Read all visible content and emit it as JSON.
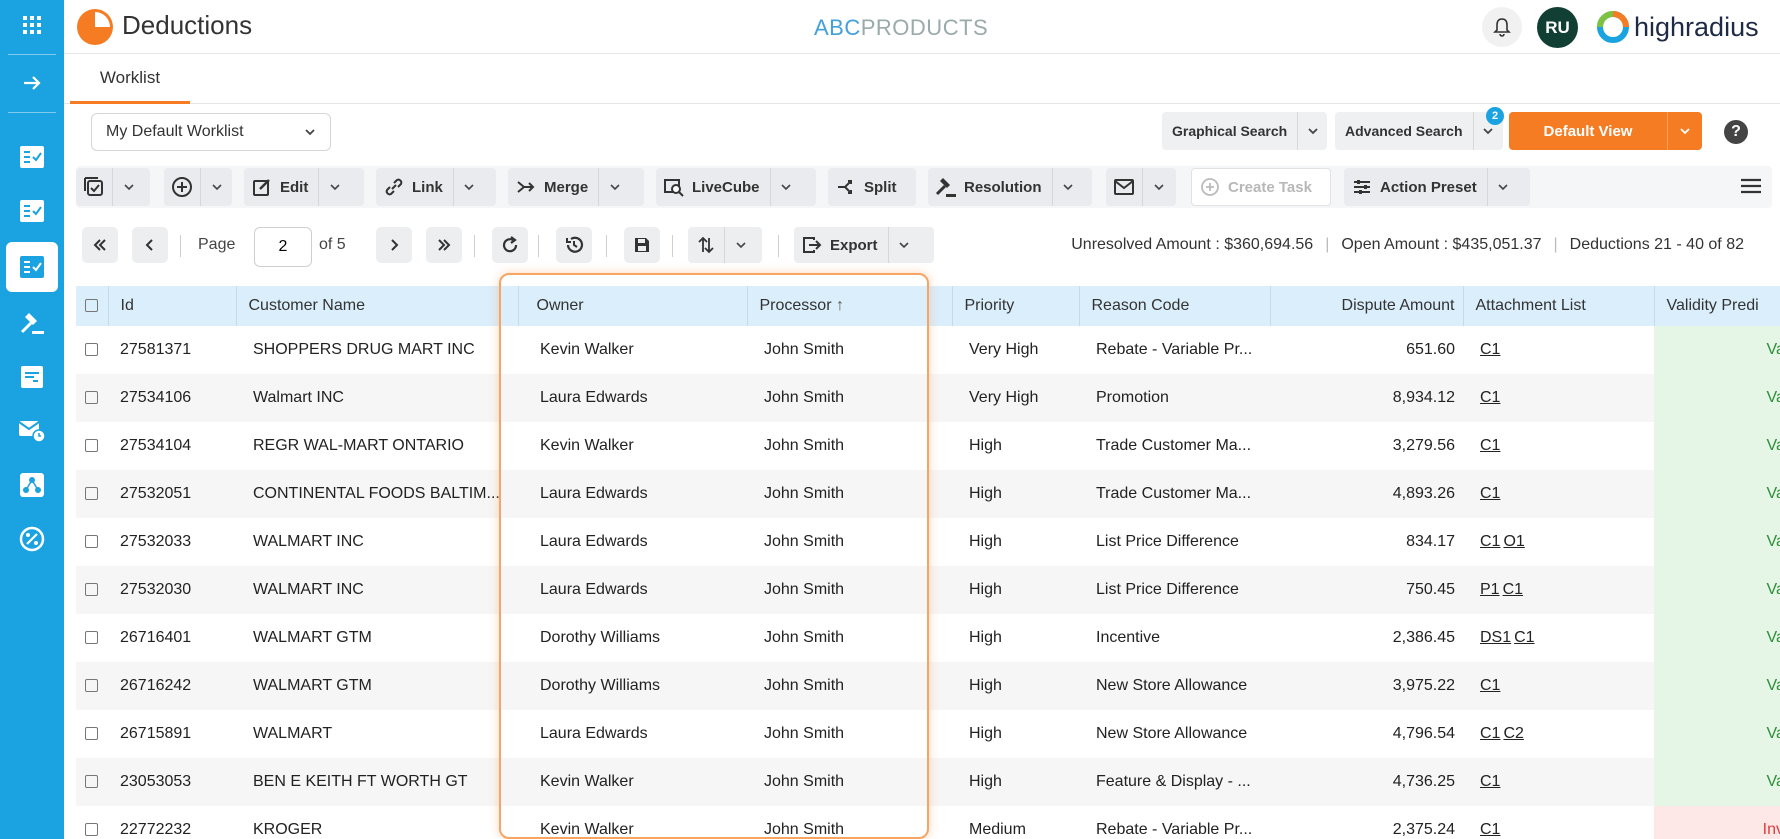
{
  "app": {
    "title": "Deductions",
    "tenant_prefix": "ABC",
    "tenant_suffix": "PRODUCTS",
    "avatar": "RU",
    "vendor": "highradius"
  },
  "tabs": [
    {
      "label": "Worklist"
    }
  ],
  "worklist": {
    "selected": "My Default Worklist"
  },
  "search": {
    "graphical": "Graphical Search",
    "advanced": "Advanced Search",
    "advanced_badge": "2",
    "default_view": "Default View",
    "help": "?"
  },
  "toolbar": {
    "edit": "Edit",
    "link": "Link",
    "merge": "Merge",
    "livecube": "LiveCube",
    "split": "Split",
    "resolution": "Resolution",
    "create_task": "Create Task",
    "action_preset": "Action Preset"
  },
  "pager": {
    "page_label": "Page",
    "page_value": "2",
    "of_label": "of 5",
    "export": "Export"
  },
  "summary": {
    "unresolved": "Unresolved Amount : $360,694.56",
    "open": "Open Amount : $435,051.37",
    "range": "Deductions 21 - 40 of 82"
  },
  "columns": [
    "Id",
    "Customer Name",
    "Owner",
    "Processor",
    "Priority",
    "Reason Code",
    "Dispute Amount",
    "Attachment List",
    "Validity Predi"
  ],
  "rows": [
    {
      "id": "27581371",
      "customer": "SHOPPERS DRUG MART INC",
      "owner": "Kevin Walker",
      "processor": "John Smith",
      "priority": "Very High",
      "reason": "Rebate - Variable Pr...",
      "amount": "651.60",
      "att1": "C1",
      "att2": "",
      "validity": "Valic"
    },
    {
      "id": "27534106",
      "customer": "Walmart INC",
      "owner": "Laura Edwards",
      "processor": "John Smith",
      "priority": "Very High",
      "reason": "Promotion",
      "amount": "8,934.12",
      "att1": "C1",
      "att2": "",
      "validity": "Valic"
    },
    {
      "id": "27534104",
      "customer": "REGR WAL-MART ONTARIO",
      "owner": "Kevin Walker",
      "processor": "John Smith",
      "priority": "High",
      "reason": "Trade Customer Ma...",
      "amount": "3,279.56",
      "att1": "C1",
      "att2": "",
      "validity": "Valic"
    },
    {
      "id": "27532051",
      "customer": "CONTINENTAL FOODS BALTIM...",
      "owner": "Laura Edwards",
      "processor": "John Smith",
      "priority": "High",
      "reason": "Trade Customer Ma...",
      "amount": "4,893.26",
      "att1": "C1",
      "att2": "",
      "validity": "Valic"
    },
    {
      "id": "27532033",
      "customer": "WALMART INC",
      "owner": "Laura Edwards",
      "processor": "John Smith",
      "priority": "High",
      "reason": "List Price Difference",
      "amount": "834.17",
      "att1": "C1",
      "att2": "O1",
      "validity": "Valic"
    },
    {
      "id": "27532030",
      "customer": "WALMART INC",
      "owner": "Laura Edwards",
      "processor": "John Smith",
      "priority": "High",
      "reason": "List Price Difference",
      "amount": "750.45",
      "att1": "P1",
      "att2": "C1",
      "validity": "Valic"
    },
    {
      "id": "26716401",
      "customer": "WALMART GTM",
      "owner": "Dorothy Williams",
      "processor": "John Smith",
      "priority": "High",
      "reason": "Incentive",
      "amount": "2,386.45",
      "att1": "DS1",
      "att2": "C1",
      "validity": "Valic"
    },
    {
      "id": "26716242",
      "customer": "WALMART GTM",
      "owner": "Dorothy Williams",
      "processor": "John Smith",
      "priority": "High",
      "reason": "New Store Allowance",
      "amount": "3,975.22",
      "att1": "C1",
      "att2": "",
      "validity": "Valic"
    },
    {
      "id": "26715891",
      "customer": "WALMART",
      "owner": "Laura Edwards",
      "processor": "John Smith",
      "priority": "High",
      "reason": "New Store Allowance",
      "amount": "4,796.54",
      "att1": "C1",
      "att2": "C2",
      "validity": "Valic"
    },
    {
      "id": "23053053",
      "customer": "BEN E KEITH FT WORTH GT",
      "owner": "Kevin Walker",
      "processor": "John Smith",
      "priority": "High",
      "reason": "Feature & Display - ...",
      "amount": "4,736.25",
      "att1": "C1",
      "att2": "",
      "validity": "Valic"
    },
    {
      "id": "22772232",
      "customer": "KROGER",
      "owner": "Kevin Walker",
      "processor": "John Smith",
      "priority": "Medium",
      "reason": "Rebate - Variable Pr...",
      "amount": "2,375.24",
      "att1": "C1",
      "att2": "",
      "validity": "Invali"
    }
  ],
  "colors": {
    "sidebar": "#1aa3e0",
    "accent": "#f57c22",
    "header_bg": "#dbeefb",
    "valid": "#2c8f3a",
    "invalid": "#e23b3b"
  },
  "icons": [
    "apps-grid-icon",
    "arrow-right-icon",
    "checklist-icon",
    "gavel-icon",
    "mail-clock-icon",
    "network-icon",
    "percent-icon",
    "bell-icon",
    "refresh-icon",
    "history-icon",
    "save-icon",
    "sort-icon",
    "export-icon",
    "menu-icon"
  ]
}
